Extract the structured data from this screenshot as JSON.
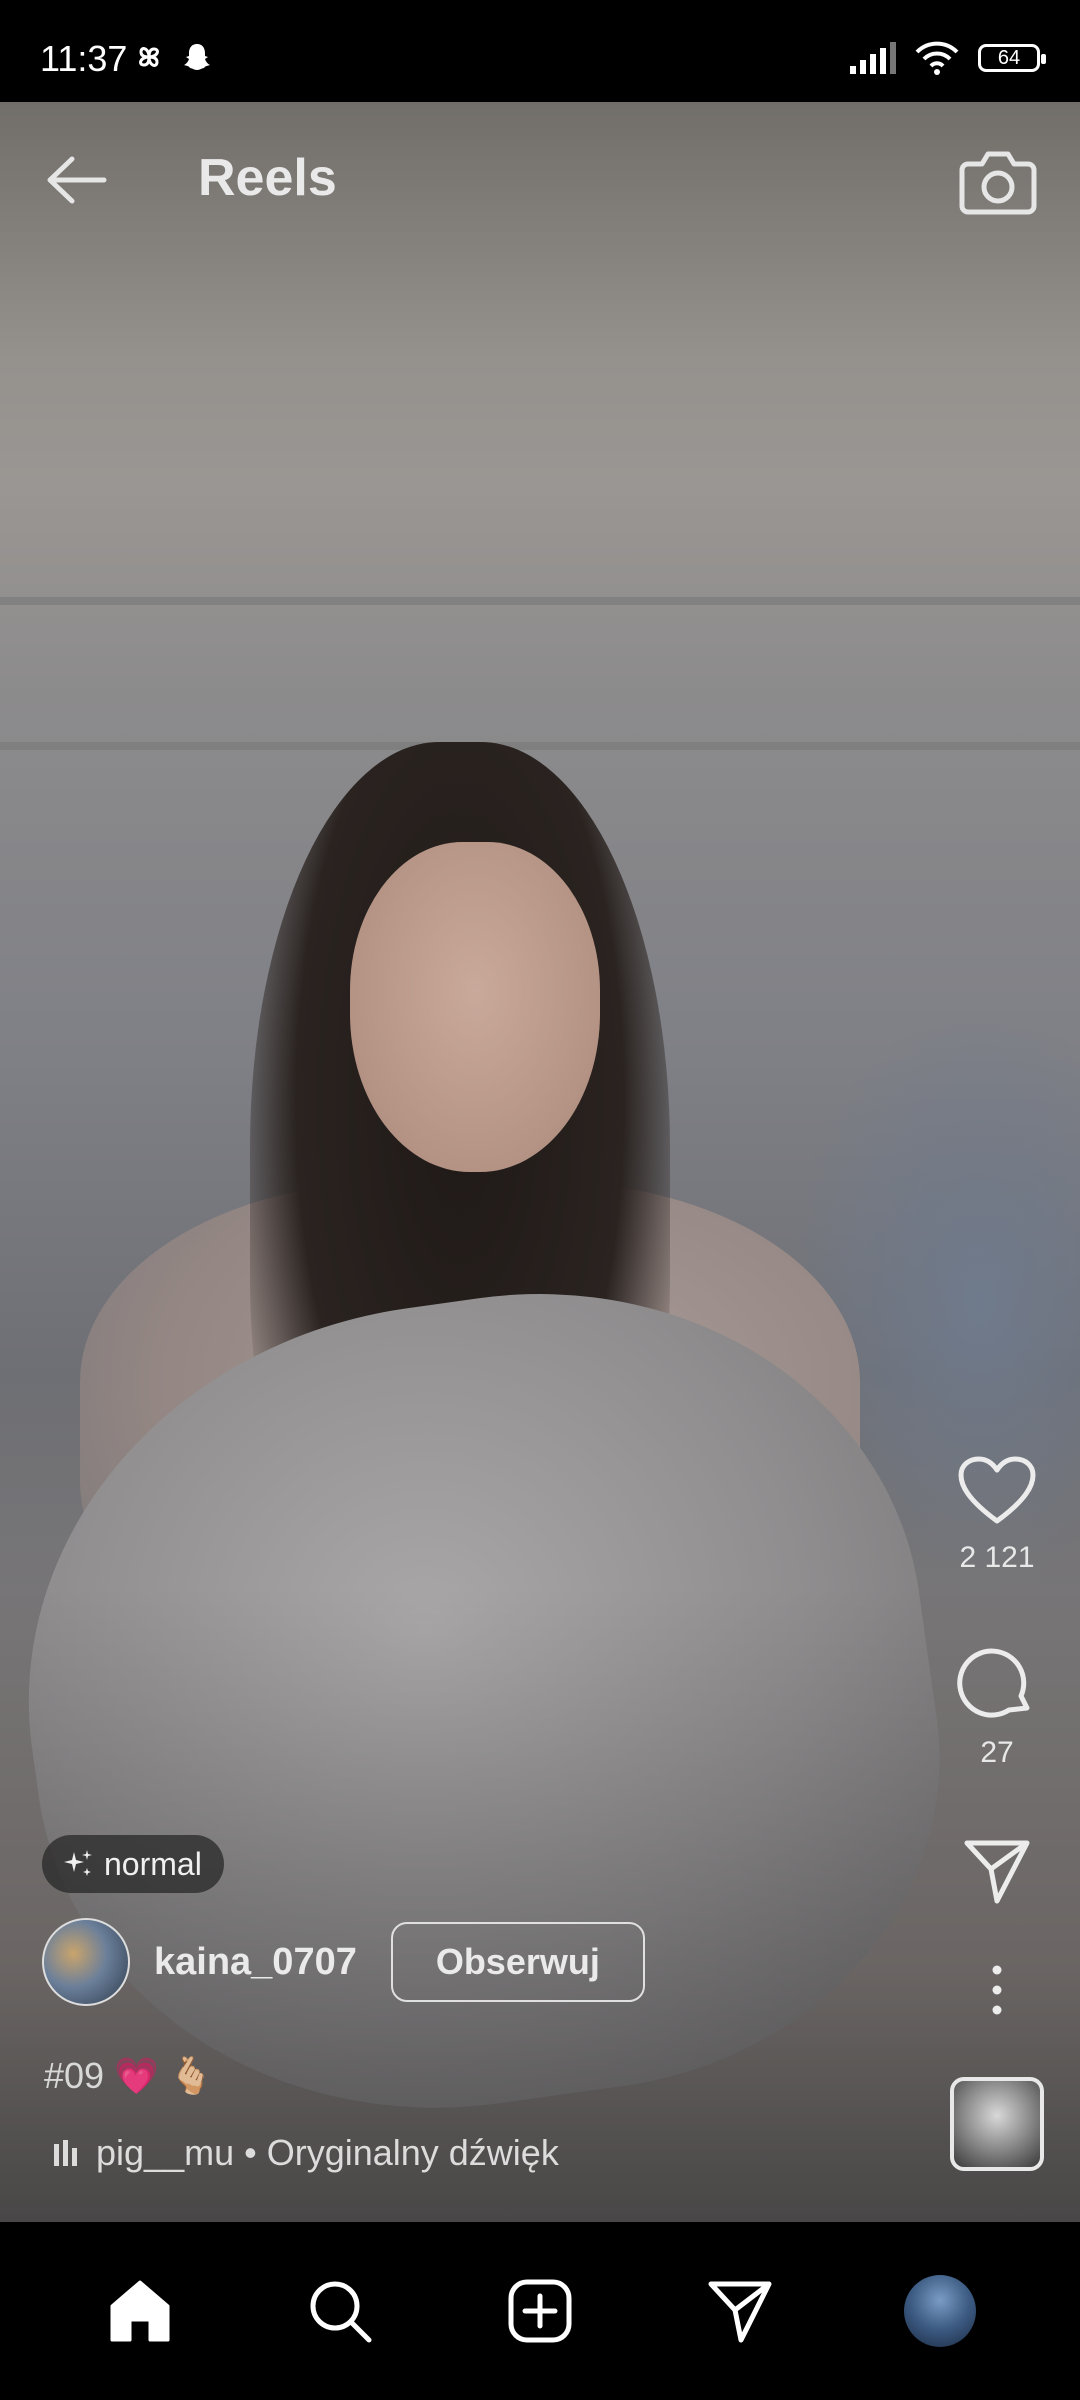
{
  "status_bar": {
    "time": "11:37",
    "battery": "64",
    "left_icons": [
      "pinwheel-icon",
      "snapchat-icon"
    ],
    "right_icons": [
      "signal-icon",
      "wifi-icon",
      "battery-icon"
    ]
  },
  "header": {
    "title": "Reels",
    "back_icon": "arrow-left-icon",
    "camera_icon": "camera-icon"
  },
  "actions": {
    "likes": "2 121",
    "comments": "27"
  },
  "effect": {
    "label": "normal",
    "icon": "sparkle-icon"
  },
  "post": {
    "username": "kaina_0707",
    "follow_label": "Obserwuj",
    "caption": "#09",
    "caption_emoji": [
      "💗",
      "🫰🏼"
    ]
  },
  "audio": {
    "text": "pig__mu • Oryginalny dźwięk"
  },
  "bottom_nav": {
    "items": [
      "home-icon",
      "search-icon",
      "create-icon",
      "direct-icon",
      "profile-avatar"
    ]
  },
  "colors": {
    "bar_background": "#000000",
    "overlay_text": "#eaeaea"
  }
}
